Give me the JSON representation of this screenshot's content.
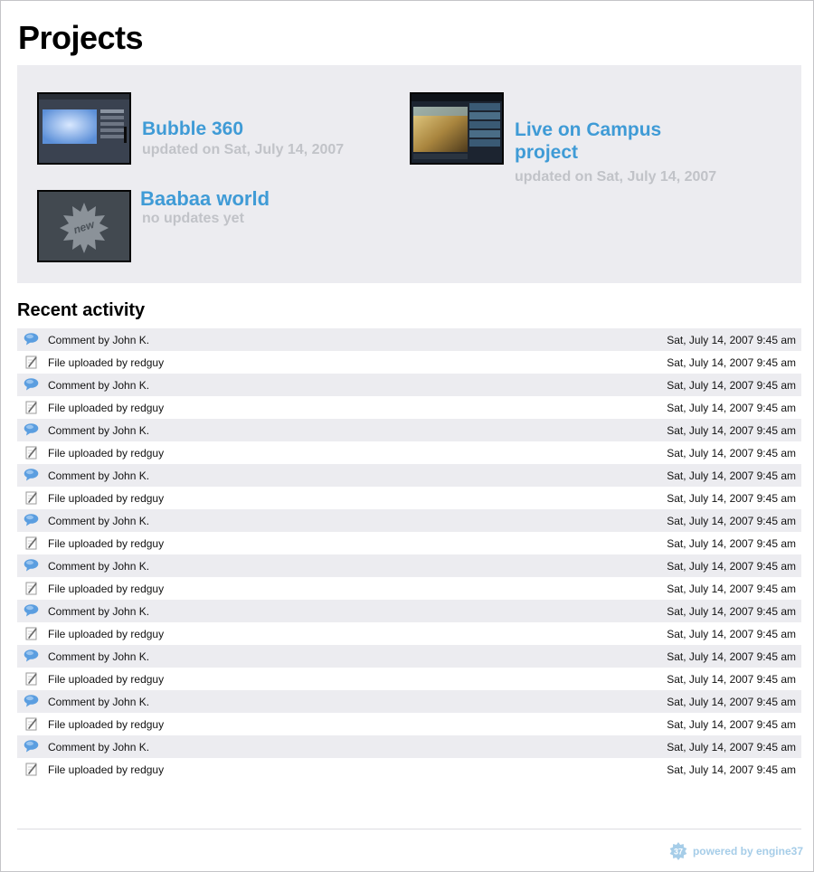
{
  "page": {
    "title": "Projects"
  },
  "projects": [
    {
      "name": "Bubble 360",
      "meta": "updated on Sat, July 14, 2007",
      "thumb": "screenshot-thumbnail"
    },
    {
      "name": "Live on Campus project",
      "meta": "updated on Sat, July 14, 2007",
      "thumb": "video-thumbnail"
    },
    {
      "name": "Baabaa world",
      "meta": "no updates yet",
      "thumb": "new-badge",
      "badge": "new"
    }
  ],
  "activity": {
    "title": "Recent activity",
    "items": [
      {
        "type": "comment",
        "icon": "speech-bubble-icon",
        "text": "Comment by John K.",
        "date": "Sat, July 14, 2007 9:45 am"
      },
      {
        "type": "upload",
        "icon": "pencil-document-icon",
        "text": "File uploaded by redguy",
        "date": "Sat, July 14, 2007 9:45 am"
      },
      {
        "type": "comment",
        "icon": "speech-bubble-icon",
        "text": "Comment by John K.",
        "date": "Sat, July 14, 2007 9:45 am"
      },
      {
        "type": "upload",
        "icon": "pencil-document-icon",
        "text": "File uploaded by redguy",
        "date": "Sat, July 14, 2007 9:45 am"
      },
      {
        "type": "comment",
        "icon": "speech-bubble-icon",
        "text": "Comment by John K.",
        "date": "Sat, July 14, 2007 9:45 am"
      },
      {
        "type": "upload",
        "icon": "pencil-document-icon",
        "text": "File uploaded by redguy",
        "date": "Sat, July 14, 2007 9:45 am"
      },
      {
        "type": "comment",
        "icon": "speech-bubble-icon",
        "text": "Comment by John K.",
        "date": "Sat, July 14, 2007 9:45 am"
      },
      {
        "type": "upload",
        "icon": "pencil-document-icon",
        "text": "File uploaded by redguy",
        "date": "Sat, July 14, 2007 9:45 am"
      },
      {
        "type": "comment",
        "icon": "speech-bubble-icon",
        "text": "Comment by John K.",
        "date": "Sat, July 14, 2007 9:45 am"
      },
      {
        "type": "upload",
        "icon": "pencil-document-icon",
        "text": "File uploaded by redguy",
        "date": "Sat, July 14, 2007 9:45 am"
      },
      {
        "type": "comment",
        "icon": "speech-bubble-icon",
        "text": "Comment by John K.",
        "date": "Sat, July 14, 2007 9:45 am"
      },
      {
        "type": "upload",
        "icon": "pencil-document-icon",
        "text": "File uploaded by redguy",
        "date": "Sat, July 14, 2007 9:45 am"
      },
      {
        "type": "comment",
        "icon": "speech-bubble-icon",
        "text": "Comment by John K.",
        "date": "Sat, July 14, 2007 9:45 am"
      },
      {
        "type": "upload",
        "icon": "pencil-document-icon",
        "text": "File uploaded by redguy",
        "date": "Sat, July 14, 2007 9:45 am"
      },
      {
        "type": "comment",
        "icon": "speech-bubble-icon",
        "text": "Comment by John K.",
        "date": "Sat, July 14, 2007 9:45 am"
      },
      {
        "type": "upload",
        "icon": "pencil-document-icon",
        "text": "File uploaded by redguy",
        "date": "Sat, July 14, 2007 9:45 am"
      },
      {
        "type": "comment",
        "icon": "speech-bubble-icon",
        "text": "Comment by John K.",
        "date": "Sat, July 14, 2007 9:45 am"
      },
      {
        "type": "upload",
        "icon": "pencil-document-icon",
        "text": "File uploaded by redguy",
        "date": "Sat, July 14, 2007 9:45 am"
      },
      {
        "type": "comment",
        "icon": "speech-bubble-icon",
        "text": "Comment by John K.",
        "date": "Sat, July 14, 2007 9:45 am"
      },
      {
        "type": "upload",
        "icon": "pencil-document-icon",
        "text": "File uploaded by redguy",
        "date": "Sat, July 14, 2007 9:45 am"
      }
    ]
  },
  "footer": {
    "powered_by": "powered by engine37",
    "logo_text": "37",
    "logo_icon": "engine37-gear-icon"
  },
  "colors": {
    "link": "#3f9bd6",
    "muted": "#c1c3c8",
    "panel_bg": "#ececf0",
    "comment_icon": "#5b9ee0",
    "footer_link": "#a6cde8"
  }
}
